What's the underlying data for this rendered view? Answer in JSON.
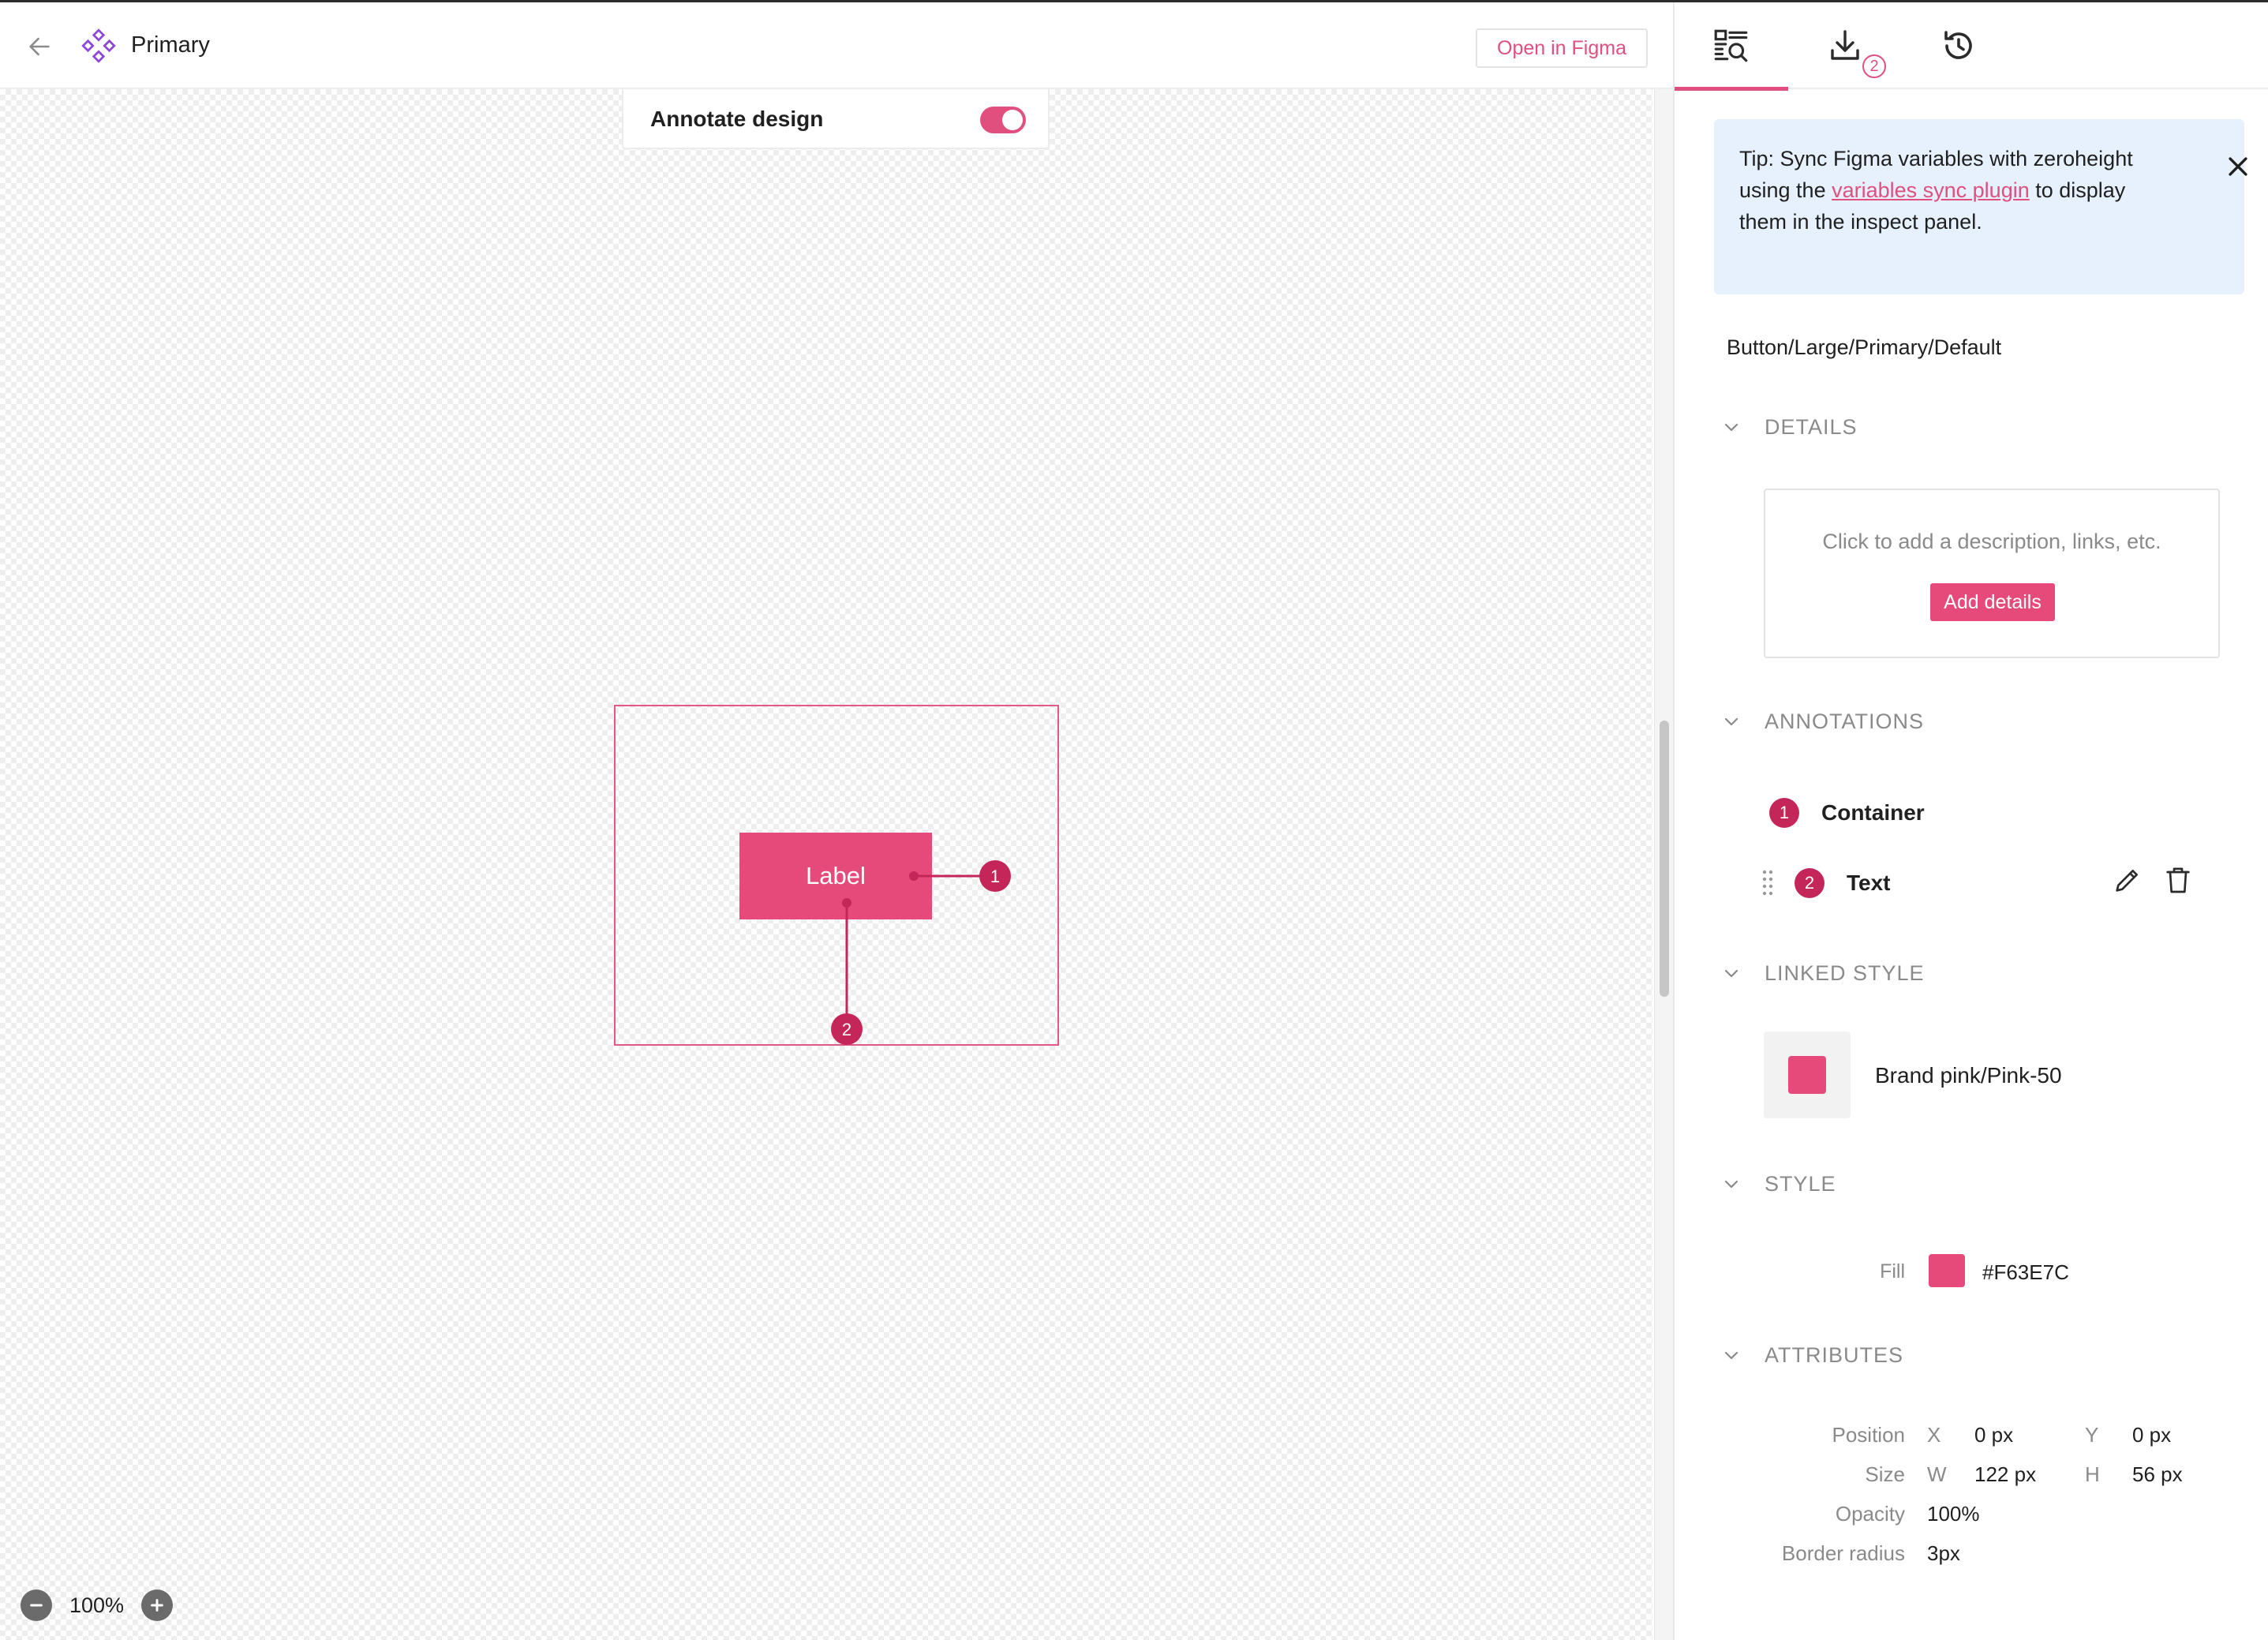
{
  "header": {
    "title": "Primary",
    "open_in_figma": "Open in Figma"
  },
  "canvas": {
    "annotate_label": "Annotate design",
    "annotate_enabled": true,
    "component_label": "Label",
    "markers": [
      "1",
      "2"
    ],
    "zoom": "100%"
  },
  "colors": {
    "accent": "#E04F7D",
    "fill": "#E64A7B",
    "marker": "#C42659",
    "tip_bg": "#E6F1FD"
  },
  "tabs": {
    "items": [
      {
        "icon": "inspect-icon",
        "active": true
      },
      {
        "icon": "download-icon",
        "active": false
      },
      {
        "icon": "history-icon",
        "active": false
      }
    ],
    "download_badge": "2"
  },
  "tip": {
    "prefix": "Tip: Sync Figma variables with zeroheight using the ",
    "link": "variables sync plugin",
    "suffix": " to display them in the inspect panel."
  },
  "component_path": "Button/Large/Primary/Default",
  "sections": {
    "details": "DETAILS",
    "annotations": "ANNOTATIONS",
    "linked_style": "LINKED STYLE",
    "style": "STYLE",
    "attributes": "ATTRIBUTES"
  },
  "details": {
    "hint": "Click to add a description, links, etc.",
    "button": "Add details"
  },
  "annotations": [
    {
      "number": "1",
      "name": "Container"
    },
    {
      "number": "2",
      "name": "Text"
    }
  ],
  "linked_style": {
    "name": "Brand pink/Pink-50"
  },
  "style": {
    "fill_label": "Fill",
    "fill_value": "#F63E7C"
  },
  "attributes": {
    "position_label": "Position",
    "size_label": "Size",
    "opacity_label": "Opacity",
    "radius_label": "Border radius",
    "x_axis": "X",
    "y_axis": "Y",
    "w_axis": "W",
    "h_axis": "H",
    "x_val": "0 px",
    "y_val": "0 px",
    "w_val": "122 px",
    "h_val": "56 px",
    "opacity_val": "100%",
    "radius_val": "3px"
  }
}
